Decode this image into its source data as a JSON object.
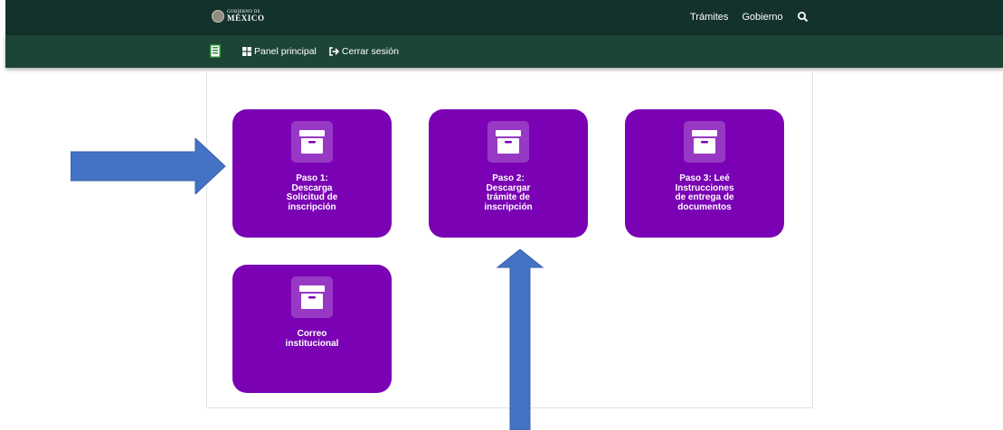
{
  "header": {
    "logo_small": "GOBIERNO DE",
    "logo_big": "MÉXICO",
    "nav": [
      "Trámites",
      "Gobierno"
    ],
    "search_icon": "search-icon"
  },
  "subnav": {
    "panel_label": "Panel principal",
    "logout_label": "Cerrar sesión"
  },
  "cards": [
    {
      "label": "Paso 1:\nDescarga\nSolicitud de\ninscripción",
      "icon": "archive-box-icon"
    },
    {
      "label": "Paso 2:\nDescargar\ntrámite de\ninscripción",
      "icon": "archive-box-icon"
    },
    {
      "label": "Paso 3: Leé\nInstrucciones\nde entrega de\ndocumentos",
      "icon": "archive-box-icon"
    },
    {
      "label": "Correo\ninstitucional",
      "icon": "archive-box-icon"
    }
  ],
  "colors": {
    "header_bg": "#13322b",
    "subbar_bg": "#1d4537",
    "card_bg": "#7a02b4",
    "arrow": "#4472c4"
  }
}
